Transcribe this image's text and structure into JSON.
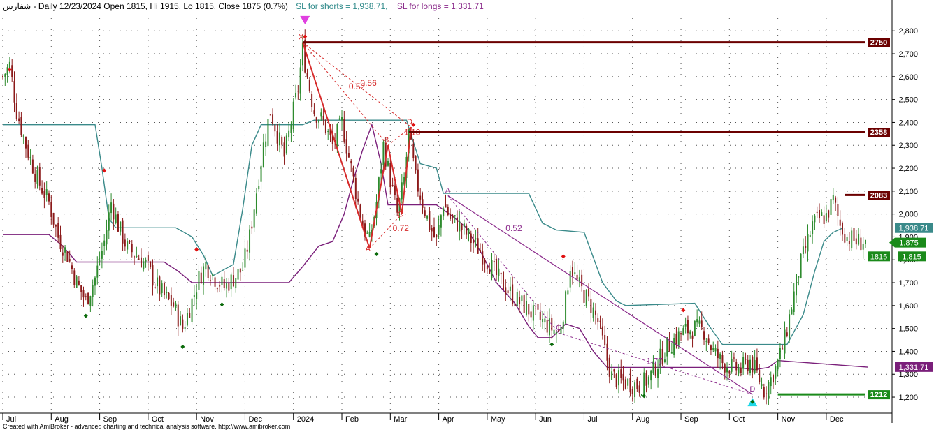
{
  "header": {
    "title": "شفارس - Daily 12/23/2024 Open 1815, Hi 1915, Lo 1815, Close 1875 (0.7%)",
    "sl_shorts": "SL for shorts  = 1,938.71,",
    "sl_longs": "SL for longs  = 1,331.71"
  },
  "footer": {
    "text": "Created with AmiBroker - advanced charting and technical analysis software. http://www.amibroker.com"
  },
  "colors": {
    "up": "#2e8b2e",
    "down": "#8b1a1a",
    "stop_short": "#3a8a8a",
    "stop_long": "#7a1f7a",
    "resistance": "#6b0000",
    "support": "#1a8a1a",
    "harmonic": "#d62a2a",
    "harmonic2": "#8b2a8b"
  },
  "chart_data": {
    "type": "candlestick",
    "ylim": [
      1130,
      2880
    ],
    "y_ticks": [
      "1,200",
      "1,300",
      "1,400",
      "1,500",
      "1,600",
      "1,700",
      "1,800",
      "1,900",
      "2,000",
      "2,100",
      "2,200",
      "2,300",
      "2,400",
      "2,500",
      "2,600",
      "2,700",
      "2,800"
    ],
    "x_ticks": [
      "Jul",
      "Aug",
      "Sep",
      "Oct",
      "Nov",
      "Dec",
      "2024",
      "Feb",
      "Mar",
      "Apr",
      "May",
      "Jun",
      "Jul",
      "Aug",
      "Sep",
      "Oct",
      "Nov",
      "Dec"
    ],
    "x_tick_index": [
      0,
      21,
      42,
      63,
      84,
      105,
      126,
      147,
      168,
      189,
      210,
      231,
      252,
      273,
      294,
      315,
      336,
      357
    ],
    "n_bars": 375,
    "close_path": [
      [
        0,
        2600
      ],
      [
        3,
        2650
      ],
      [
        6,
        2450
      ],
      [
        10,
        2300
      ],
      [
        15,
        2150
      ],
      [
        20,
        2050
      ],
      [
        24,
        1900
      ],
      [
        28,
        1820
      ],
      [
        32,
        1700
      ],
      [
        36,
        1620
      ],
      [
        40,
        1720
      ],
      [
        44,
        1880
      ],
      [
        47,
        2050
      ],
      [
        50,
        1950
      ],
      [
        54,
        1850
      ],
      [
        58,
        1820
      ],
      [
        62,
        1780
      ],
      [
        66,
        1700
      ],
      [
        70,
        1640
      ],
      [
        74,
        1600
      ],
      [
        78,
        1500
      ],
      [
        82,
        1620
      ],
      [
        85,
        1720
      ],
      [
        88,
        1780
      ],
      [
        92,
        1720
      ],
      [
        96,
        1680
      ],
      [
        100,
        1720
      ],
      [
        104,
        1760
      ],
      [
        107,
        1900
      ],
      [
        110,
        2100
      ],
      [
        113,
        2300
      ],
      [
        116,
        2450
      ],
      [
        119,
        2350
      ],
      [
        122,
        2250
      ],
      [
        125,
        2400
      ],
      [
        128,
        2550
      ],
      [
        130,
        2720
      ],
      [
        132,
        2600
      ],
      [
        135,
        2450
      ],
      [
        139,
        2400
      ],
      [
        143,
        2300
      ],
      [
        147,
        2400
      ],
      [
        150,
        2250
      ],
      [
        153,
        2100
      ],
      [
        156,
        1950
      ],
      [
        159,
        1880
      ],
      [
        162,
        2050
      ],
      [
        165,
        2300
      ],
      [
        168,
        2150
      ],
      [
        171,
        2000
      ],
      [
        174,
        2150
      ],
      [
        176,
        2350
      ],
      [
        179,
        2150
      ],
      [
        182,
        2050
      ],
      [
        185,
        1950
      ],
      [
        188,
        1880
      ],
      [
        191,
        2050
      ],
      [
        194,
        1980
      ],
      [
        198,
        1950
      ],
      [
        202,
        1900
      ],
      [
        206,
        1850
      ],
      [
        210,
        1800
      ],
      [
        214,
        1730
      ],
      [
        218,
        1680
      ],
      [
        222,
        1630
      ],
      [
        226,
        1600
      ],
      [
        230,
        1560
      ],
      [
        234,
        1530
      ],
      [
        238,
        1500
      ],
      [
        241,
        1480
      ],
      [
        244,
        1620
      ],
      [
        246,
        1780
      ],
      [
        249,
        1700
      ],
      [
        252,
        1650
      ],
      [
        255,
        1600
      ],
      [
        258,
        1530
      ],
      [
        261,
        1400
      ],
      [
        264,
        1290
      ],
      [
        268,
        1270
      ],
      [
        272,
        1260
      ],
      [
        276,
        1250
      ],
      [
        280,
        1280
      ],
      [
        284,
        1350
      ],
      [
        288,
        1420
      ],
      [
        292,
        1460
      ],
      [
        296,
        1490
      ],
      [
        300,
        1500
      ],
      [
        304,
        1490
      ],
      [
        308,
        1400
      ],
      [
        312,
        1350
      ],
      [
        316,
        1330
      ],
      [
        320,
        1320
      ],
      [
        324,
        1360
      ],
      [
        327,
        1300
      ],
      [
        330,
        1230
      ],
      [
        333,
        1280
      ],
      [
        336,
        1350
      ],
      [
        339,
        1450
      ],
      [
        342,
        1600
      ],
      [
        345,
        1750
      ],
      [
        348,
        1850
      ],
      [
        351,
        1950
      ],
      [
        354,
        1980
      ],
      [
        357,
        1990
      ],
      [
        360,
        2060
      ],
      [
        363,
        1950
      ],
      [
        366,
        1900
      ],
      [
        370,
        1880
      ]
    ],
    "stop_short_path": [
      [
        0,
        2390
      ],
      [
        40,
        2390
      ],
      [
        43,
        2200
      ],
      [
        46,
        1980
      ],
      [
        49,
        1940
      ],
      [
        75,
        1940
      ],
      [
        82,
        1900
      ],
      [
        87,
        1820
      ],
      [
        91,
        1730
      ],
      [
        100,
        1780
      ],
      [
        104,
        2020
      ],
      [
        108,
        2300
      ],
      [
        112,
        2390
      ],
      [
        130,
        2390
      ],
      [
        135,
        2410
      ],
      [
        175,
        2410
      ],
      [
        181,
        2220
      ],
      [
        188,
        2200
      ],
      [
        191,
        2090
      ],
      [
        220,
        2090
      ],
      [
        228,
        2090
      ],
      [
        234,
        1960
      ],
      [
        240,
        1930
      ],
      [
        252,
        1920
      ],
      [
        260,
        1700
      ],
      [
        266,
        1620
      ],
      [
        270,
        1600
      ],
      [
        300,
        1610
      ],
      [
        307,
        1500
      ],
      [
        312,
        1430
      ],
      [
        340,
        1430
      ],
      [
        347,
        1560
      ],
      [
        352,
        1750
      ],
      [
        356,
        1880
      ],
      [
        360,
        1920
      ],
      [
        364,
        1938
      ]
    ],
    "stop_long_path": [
      [
        0,
        1910
      ],
      [
        20,
        1910
      ],
      [
        26,
        1860
      ],
      [
        32,
        1790
      ],
      [
        70,
        1790
      ],
      [
        76,
        1750
      ],
      [
        82,
        1700
      ],
      [
        124,
        1700
      ],
      [
        130,
        1770
      ],
      [
        137,
        1860
      ],
      [
        143,
        1880
      ],
      [
        148,
        2000
      ],
      [
        152,
        2150
      ],
      [
        156,
        2280
      ],
      [
        160,
        2390
      ],
      [
        164,
        2220
      ],
      [
        167,
        2040
      ],
      [
        188,
        2040
      ],
      [
        195,
        1990
      ],
      [
        201,
        1940
      ],
      [
        208,
        1820
      ],
      [
        214,
        1700
      ],
      [
        222,
        1610
      ],
      [
        228,
        1510
      ],
      [
        232,
        1460
      ],
      [
        238,
        1460
      ],
      [
        244,
        1520
      ],
      [
        250,
        1500
      ],
      [
        256,
        1400
      ],
      [
        262,
        1330
      ],
      [
        300,
        1330
      ],
      [
        318,
        1330
      ],
      [
        326,
        1320
      ],
      [
        332,
        1330
      ],
      [
        336,
        1360
      ],
      [
        375,
        1331
      ]
    ],
    "levels": [
      {
        "value": 2750,
        "label": "2750",
        "kind": "resistance",
        "from": 130
      },
      {
        "value": 2358,
        "label": "2358",
        "kind": "resistance",
        "from": 176
      },
      {
        "value": 2083,
        "label": "2083",
        "kind": "resistance",
        "from": 365
      },
      {
        "value": 1212,
        "label": "1212",
        "kind": "support",
        "from": 336
      }
    ],
    "right_labels": [
      {
        "value": 1938.71,
        "text": "1,938.71",
        "kind": "stop_short"
      },
      {
        "value": 1875,
        "text": "1,875",
        "kind": "close"
      },
      {
        "value": 1815,
        "text": "1,815",
        "kind": "open"
      },
      {
        "value": 1815,
        "text": "1815",
        "kind": "support_tag"
      },
      {
        "value": 1331.71,
        "text": "1,331.71",
        "kind": "stop_long"
      }
    ],
    "harmonic_a": {
      "points": [
        {
          "name": "X",
          "x": 130,
          "y": 2750
        },
        {
          "name": "A",
          "x": 159,
          "y": 1850
        },
        {
          "name": "B",
          "x": 167,
          "y": 2300
        },
        {
          "name": "C",
          "x": 173,
          "y": 2000
        },
        {
          "name": "D",
          "x": 177,
          "y": 2380
        }
      ],
      "ratios": [
        {
          "text": "0.56",
          "x": 155,
          "y": 2560
        },
        {
          "text": "0.52",
          "x": 150,
          "y": 2545
        },
        {
          "text": "0.72",
          "x": 169,
          "y": 1925
        },
        {
          "text": "1.13",
          "x": 174,
          "y": 2345
        }
      ]
    },
    "harmonic_b": {
      "points": [
        {
          "name": "A",
          "x": 193,
          "y": 2080
        },
        {
          "name": "C",
          "x": 241,
          "y": 1480
        },
        {
          "name": "D",
          "x": 325,
          "y": 1212
        }
      ],
      "ratios": [
        {
          "text": "0.52",
          "x": 218,
          "y": 1925
        },
        {
          "text": "1.77",
          "x": 279,
          "y": 1345
        }
      ]
    },
    "sell_marker": {
      "x": 131,
      "y": 2865
    },
    "buy_marker": {
      "x": 325,
      "y": 1160
    },
    "red_dots": [
      [
        3,
        2630
      ],
      [
        44,
        2190
      ],
      [
        84,
        1845
      ],
      [
        131,
        2775
      ],
      [
        178,
        2390
      ],
      [
        243,
        1815
      ],
      [
        295,
        1580
      ]
    ],
    "green_dots": [
      [
        36,
        1555
      ],
      [
        78,
        1420
      ],
      [
        95,
        1605
      ],
      [
        162,
        1825
      ],
      [
        238,
        1430
      ],
      [
        278,
        1205
      ],
      [
        325,
        1180
      ]
    ]
  }
}
